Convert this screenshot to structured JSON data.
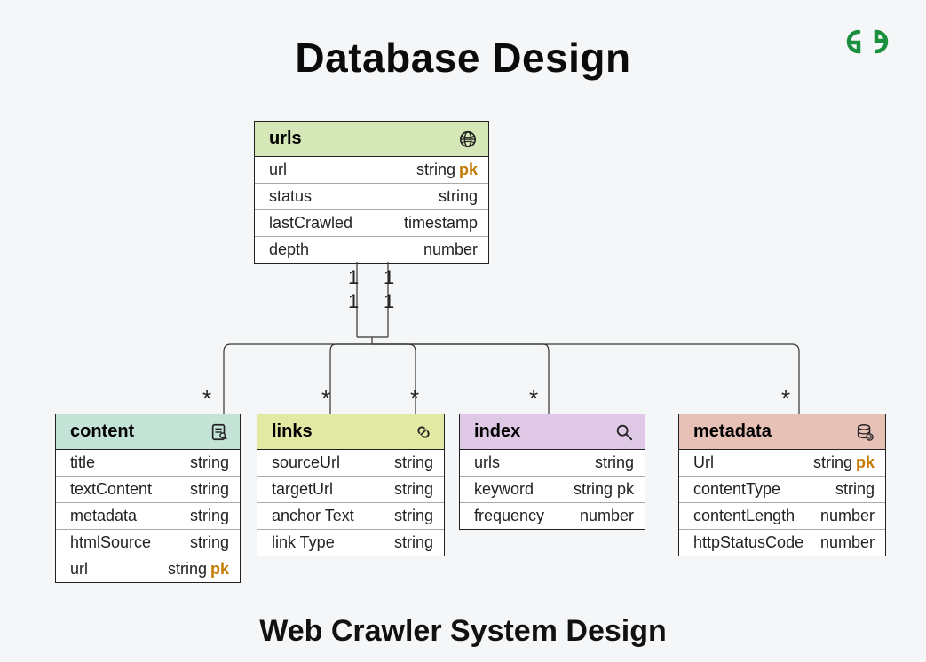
{
  "title": "Database Design",
  "subtitle": "Web Crawler System Design",
  "tables": {
    "urls": {
      "name": "urls",
      "rows": [
        {
          "name": "url",
          "type": "string",
          "pk": "pk"
        },
        {
          "name": "status",
          "type": "string",
          "pk": ""
        },
        {
          "name": "lastCrawled",
          "type": "timestamp",
          "pk": ""
        },
        {
          "name": "depth",
          "type": "number",
          "pk": ""
        }
      ]
    },
    "content": {
      "name": "content",
      "rows": [
        {
          "name": "title",
          "type": "string",
          "pk": ""
        },
        {
          "name": "textContent",
          "type": "string",
          "pk": ""
        },
        {
          "name": "metadata",
          "type": "string",
          "pk": ""
        },
        {
          "name": "htmlSource",
          "type": "string",
          "pk": ""
        },
        {
          "name": "url",
          "type": "string",
          "pk": "pk"
        }
      ]
    },
    "links": {
      "name": "links",
      "rows": [
        {
          "name": "sourceUrl",
          "type": "string",
          "pk": ""
        },
        {
          "name": "targetUrl",
          "type": "string",
          "pk": ""
        },
        {
          "name": "anchor Text",
          "type": "string",
          "pk": ""
        },
        {
          "name": "link Type",
          "type": "string",
          "pk": ""
        }
      ]
    },
    "index": {
      "name": "index",
      "rows": [
        {
          "name": "urls",
          "type": "string",
          "pk": ""
        },
        {
          "name": "keyword",
          "type": "string pk",
          "pk": ""
        },
        {
          "name": "frequency",
          "type": "number",
          "pk": ""
        }
      ]
    },
    "metadata": {
      "name": "metadata",
      "rows": [
        {
          "name": "Url",
          "type": "string",
          "pk": "pk"
        },
        {
          "name": "contentType",
          "type": "string",
          "pk": ""
        },
        {
          "name": "contentLength",
          "type": "number",
          "pk": ""
        },
        {
          "name": "httpStatusCode",
          "type": "number",
          "pk": ""
        }
      ]
    }
  },
  "cardinality": {
    "top_left": "1",
    "top_right": "1",
    "mid_left": "1",
    "mid_right": "1",
    "star": "*"
  }
}
